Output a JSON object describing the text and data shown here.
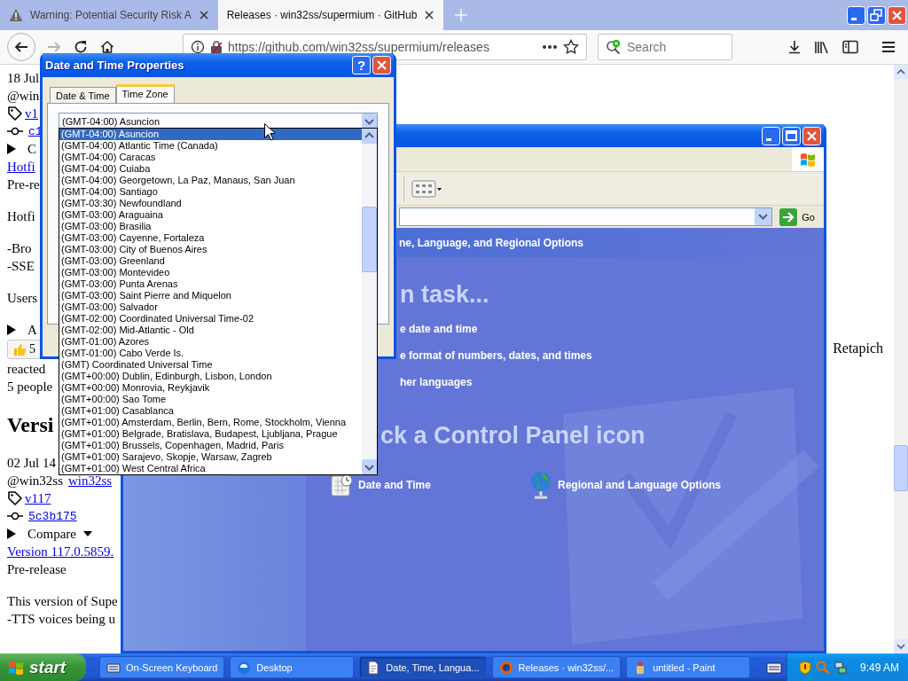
{
  "browser": {
    "tabs": [
      {
        "title": "Warning: Potential Security Risk A",
        "selected": false,
        "kind": "warning"
      },
      {
        "title": "Releases · win32ss/supermium · GitHub",
        "selected": true,
        "kind": "plain"
      }
    ],
    "forward": {
      "disabled": true
    },
    "url": "https://github.com/win32ss/supermium/releases",
    "search": {
      "placeholder": "Search"
    },
    "page": {
      "blocks": [
        {
          "kind": "lines",
          "lines": [
            {
              "kind": "text",
              "text": "18 Jul"
            },
            {
              "kind": "text",
              "text": "@win"
            },
            {
              "kind": "tag",
              "text": "v1"
            },
            {
              "kind": "commit",
              "text": "c1"
            },
            {
              "kind": "summary",
              "text": "C",
              "dropdown": false
            },
            {
              "kind": "link",
              "text": "Hotfi"
            },
            {
              "kind": "text",
              "text": "Pre-re"
            }
          ]
        },
        {
          "kind": "lines",
          "lines": [
            {
              "kind": "text",
              "text": "Hotfi"
            }
          ]
        },
        {
          "kind": "lines",
          "lines": [
            {
              "kind": "text",
              "text": "-Bro"
            },
            {
              "kind": "text",
              "text": "-SSE"
            }
          ]
        },
        {
          "kind": "lines",
          "lines": [
            {
              "kind": "text",
              "text": "Users"
            }
          ]
        },
        {
          "kind": "lines",
          "lines": [
            {
              "kind": "summary",
              "text": "A",
              "dropdown": false
            },
            {
              "kind": "reaction",
              "text": "5"
            },
            {
              "kind": "text",
              "text": "reacted"
            },
            {
              "kind": "text",
              "text": "5 people"
            }
          ]
        },
        {
          "kind": "heading",
          "text": "Versi"
        },
        {
          "kind": "lines",
          "lines": [
            {
              "kind": "text",
              "text": "02 Jul 14"
            },
            {
              "kind": "author",
              "text": "@win32ss",
              "link": "win32ss"
            },
            {
              "kind": "tag",
              "text": "v117"
            },
            {
              "kind": "commit",
              "text": "5c3b175"
            },
            {
              "kind": "summary",
              "text": "Compare",
              "dropdown": true
            },
            {
              "kind": "link",
              "text": "Version 117.0.5859."
            },
            {
              "kind": "text",
              "text": "Pre-release"
            }
          ]
        },
        {
          "kind": "lines",
          "lines": [
            {
              "kind": "text",
              "text": "This version of Supe"
            },
            {
              "kind": "text",
              "text": "-TTS voices being u"
            }
          ]
        }
      ]
    },
    "side_text": "Retapich"
  },
  "control_panel": {
    "go": "Go",
    "header": "ne, Language, and Regional Options",
    "task_heading": "n task...",
    "tasks": [
      "e date and time",
      "e format of numbers, dates, and times",
      "her languages"
    ],
    "icon_heading": "ck a Control Panel icon",
    "icons": [
      {
        "label": "Date and Time",
        "kind": "clock"
      },
      {
        "label": "Regional and Language Options",
        "kind": "globe"
      }
    ]
  },
  "dialog": {
    "title": "Date and Time Properties",
    "help": "?",
    "tabs": [
      {
        "label": "Date & Time",
        "selected": false
      },
      {
        "label": "Time Zone",
        "selected": true
      }
    ],
    "time_zone": {
      "value": "(GMT-04:00) Asuncion",
      "options": [
        {
          "label": "(GMT-04:00) Asuncion",
          "selected": true
        },
        {
          "label": "(GMT-04:00) Atlantic Time (Canada)",
          "selected": false
        },
        {
          "label": "(GMT-04:00) Caracas",
          "selected": false
        },
        {
          "label": "(GMT-04:00) Cuiaba",
          "selected": false
        },
        {
          "label": "(GMT-04:00) Georgetown, La Paz, Manaus, San Juan",
          "selected": false
        },
        {
          "label": "(GMT-04:00) Santiago",
          "selected": false
        },
        {
          "label": "(GMT-03:30) Newfoundland",
          "selected": false
        },
        {
          "label": "(GMT-03:00) Araguaina",
          "selected": false
        },
        {
          "label": "(GMT-03:00) Brasilia",
          "selected": false
        },
        {
          "label": "(GMT-03:00) Cayenne, Fortaleza",
          "selected": false
        },
        {
          "label": "(GMT-03:00) City of Buenos Aires",
          "selected": false
        },
        {
          "label": "(GMT-03:00) Greenland",
          "selected": false
        },
        {
          "label": "(GMT-03:00) Montevideo",
          "selected": false
        },
        {
          "label": "(GMT-03:00) Punta Arenas",
          "selected": false
        },
        {
          "label": "(GMT-03:00) Saint Pierre and Miquelon",
          "selected": false
        },
        {
          "label": "(GMT-03:00) Salvador",
          "selected": false
        },
        {
          "label": "(GMT-02:00) Coordinated Universal Time-02",
          "selected": false
        },
        {
          "label": "(GMT-02:00) Mid-Atlantic - Old",
          "selected": false
        },
        {
          "label": "(GMT-01:00) Azores",
          "selected": false
        },
        {
          "label": "(GMT-01:00) Cabo Verde Is.",
          "selected": false
        },
        {
          "label": "(GMT) Coordinated Universal Time",
          "selected": false
        },
        {
          "label": "(GMT+00:00) Dublin, Edinburgh, Lisbon, London",
          "selected": false
        },
        {
          "label": "(GMT+00:00) Monrovia, Reykjavik",
          "selected": false
        },
        {
          "label": "(GMT+00:00) Sao Tome",
          "selected": false
        },
        {
          "label": "(GMT+01:00) Casablanca",
          "selected": false
        },
        {
          "label": "(GMT+01:00) Amsterdam, Berlin, Bern, Rome, Stockholm, Vienna",
          "selected": false
        },
        {
          "label": "(GMT+01:00) Belgrade, Bratislava, Budapest, Ljubljana, Prague",
          "selected": false
        },
        {
          "label": "(GMT+01:00) Brussels, Copenhagen, Madrid, Paris",
          "selected": false
        },
        {
          "label": "(GMT+01:00) Sarajevo, Skopje, Warsaw, Zagreb",
          "selected": false
        },
        {
          "label": "(GMT+01:00) West Central Africa",
          "selected": false
        }
      ]
    }
  },
  "taskbar": {
    "start": "start",
    "items": [
      {
        "label": "On-Screen Keyboard",
        "selected": false,
        "kind": "keyboard"
      },
      {
        "label": "Desktop",
        "selected": false,
        "kind": "browser"
      },
      {
        "label": "Date, Time, Langua...",
        "selected": true,
        "kind": "document"
      },
      {
        "label": "Releases · win32ss/...",
        "selected": false,
        "kind": "fox"
      },
      {
        "label": "untitled - Paint",
        "selected": false,
        "kind": "paint"
      }
    ],
    "clock": "9:49 AM"
  }
}
